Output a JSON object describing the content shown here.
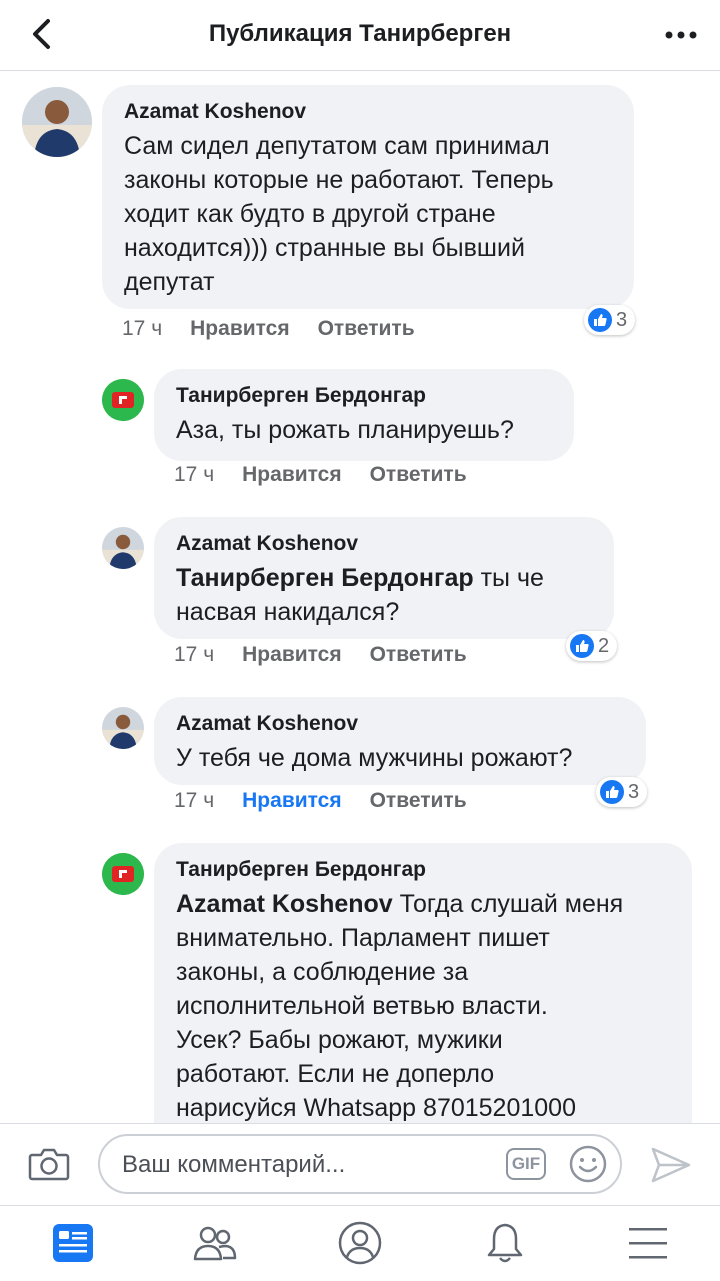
{
  "header": {
    "title": "Публикация Танирберген",
    "back_icon": "chevron-left-icon",
    "more_icon": "more-horizontal-icon"
  },
  "comments": [
    {
      "author": "Azamat Koshenov",
      "text_lines": [
        "Сам сидел депутатом сам принимал",
        "законы которые не работают. Теперь",
        "ходит как будто в другой стране",
        "находится))) странные вы бывший",
        "депутат"
      ],
      "time": "17 ч",
      "like_label": "Нравится",
      "reply_label": "Ответить",
      "reactions": "3"
    },
    {
      "author": "Танирберген Бердонгар",
      "text_lines": [
        "Аза, ты рожать планируешь?"
      ],
      "time": "17 ч",
      "like_label": "Нравится",
      "reply_label": "Ответить"
    },
    {
      "author": "Azamat Koshenov",
      "mention": "Танирберген Бердонгар",
      "text_after_mention": "ты че",
      "text_lines": [
        "насвая накидался?"
      ],
      "time": "17 ч",
      "like_label": "Нравится",
      "reply_label": "Ответить",
      "reactions": "2"
    },
    {
      "author": "Azamat Koshenov",
      "text_lines": [
        "У тебя че дома мужчины рожают?"
      ],
      "time": "17 ч",
      "like_label": "Нравится",
      "liked": true,
      "reply_label": "Ответить",
      "reactions": "3"
    },
    {
      "author": "Танирберген Бердонгар",
      "mention": "Azamat Koshenov",
      "text_after_mention": "Тогда слушай меня",
      "text_lines": [
        "внимательно. Парламент пишет",
        "законы, а соблюдение за",
        "исполнительной ветвью власти.",
        "Усек? Бабы рожают, мужики",
        "работают. Если не доперло",
        "нарисуйся Whatsapp 87015201000"
      ]
    }
  ],
  "composer": {
    "placeholder": "Ваш комментарий...",
    "gif_label": "GIF",
    "camera_icon": "camera-icon",
    "emoji_icon": "smiley-icon",
    "send_icon": "send-icon"
  },
  "tabs": [
    {
      "icon": "news-feed-icon",
      "active": true
    },
    {
      "icon": "friends-icon"
    },
    {
      "icon": "profile-icon"
    },
    {
      "icon": "notifications-bell-icon"
    },
    {
      "icon": "menu-icon"
    }
  ],
  "colors": {
    "accent": "#1877f2",
    "bubble": "#f0f2f5",
    "meta_text": "#65676b",
    "page_avatar_bg": "#2db84d",
    "page_avatar_mark": "#e02424"
  }
}
